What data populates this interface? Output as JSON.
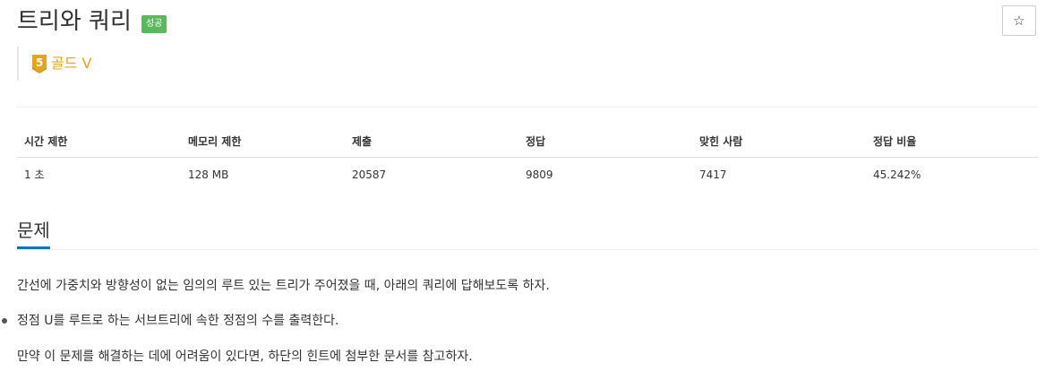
{
  "problem": {
    "title": "트리와 쿼리",
    "status_badge": "성공",
    "star_icon": "☆",
    "tier": {
      "number": "5",
      "label": "골드 V",
      "color": "#e6a51a"
    }
  },
  "info_table": {
    "headers": [
      "시간 제한",
      "메모리 제한",
      "제출",
      "정답",
      "맞힌 사람",
      "정답 비율"
    ],
    "values": [
      "1 초",
      "128 MB",
      "20587",
      "9809",
      "7417",
      "45.242%"
    ]
  },
  "section": {
    "title": "문제",
    "paragraph1": "간선에 가중치와 방향성이 없는 임의의 루트 있는 트리가 주어졌을 때, 아래의 쿼리에 답해보도록 하자.",
    "bullet1": "정점 U를 루트로 하는 서브트리에 속한 정점의 수를 출력한다.",
    "paragraph2": "만약 이 문제를 해결하는 데에 어려움이 있다면, 하단의 힌트에 첨부한 문서를 참고하자."
  },
  "colors": {
    "success": "#5cb85c",
    "accent": "#0076c0",
    "tier_gold": "#e6a51a"
  }
}
